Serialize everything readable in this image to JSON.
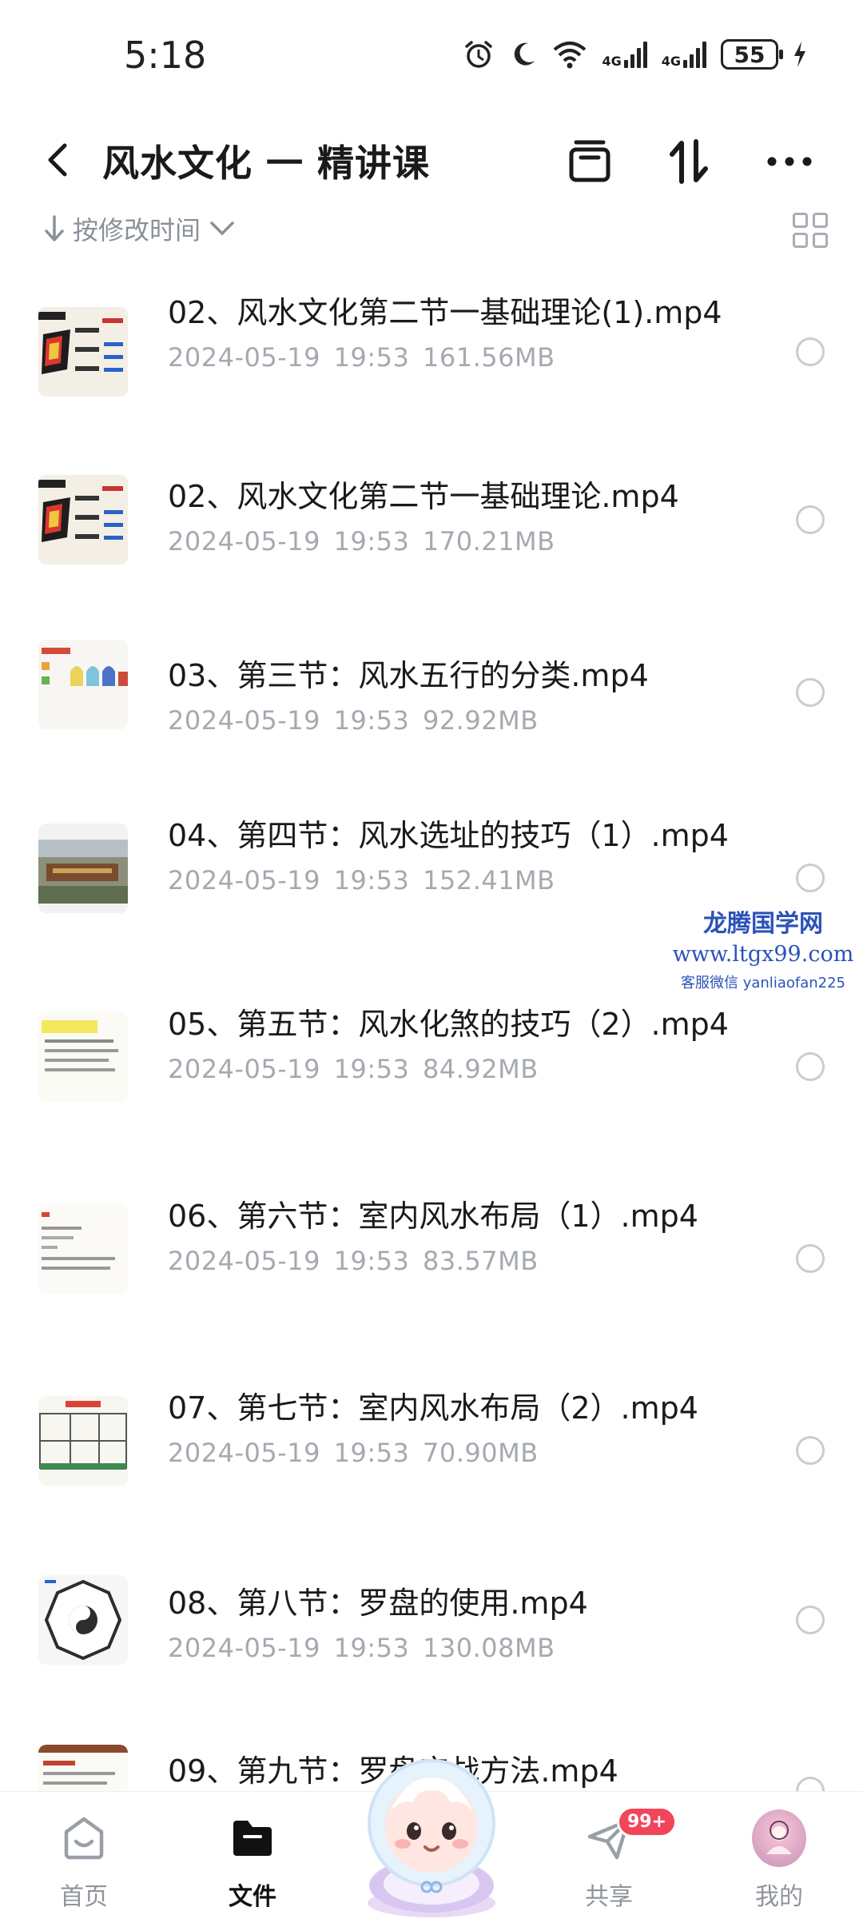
{
  "status_bar": {
    "time": "5:18",
    "battery": "55",
    "net1": "4G",
    "net2": "4G"
  },
  "header": {
    "title": "风水文化 一 精讲课"
  },
  "sort": {
    "label": "按修改时间"
  },
  "files": [
    {
      "name": "02、风水文化第二节一基础理论(1).mp4",
      "date": "2024-05-19",
      "time": "19:53",
      "size": "161.56MB"
    },
    {
      "name": "02、风水文化第二节一基础理论.mp4",
      "date": "2024-05-19",
      "time": "19:53",
      "size": "170.21MB"
    },
    {
      "name": "03、第三节：风水五行的分类.mp4",
      "date": "2024-05-19",
      "time": "19:53",
      "size": "92.92MB"
    },
    {
      "name": "04、第四节：风水选址的技巧（1）.mp4",
      "date": "2024-05-19",
      "time": "19:53",
      "size": "152.41MB"
    },
    {
      "name": "05、第五节：风水化煞的技巧（2）.mp4",
      "date": "2024-05-19",
      "time": "19:53",
      "size": "84.92MB"
    },
    {
      "name": "06、第六节：室内风水布局（1）.mp4",
      "date": "2024-05-19",
      "time": "19:53",
      "size": "83.57MB"
    },
    {
      "name": "07、第七节：室内风水布局（2）.mp4",
      "date": "2024-05-19",
      "time": "19:53",
      "size": "70.90MB"
    },
    {
      "name": "08、第八节：罗盘的使用.mp4",
      "date": "2024-05-19",
      "time": "19:53",
      "size": "130.08MB"
    },
    {
      "name": "09、第九节：罗盘实战方法.mp4",
      "date": "",
      "time": "",
      "size": ""
    }
  ],
  "watermark": {
    "line1": "龙腾国学网",
    "line2": "www.ltgx99.com",
    "line3": "客服微信 yanliaofan225"
  },
  "nav": {
    "home": "首页",
    "files": "文件",
    "share": "共享",
    "share_badge": "99+",
    "mine": "我的"
  }
}
